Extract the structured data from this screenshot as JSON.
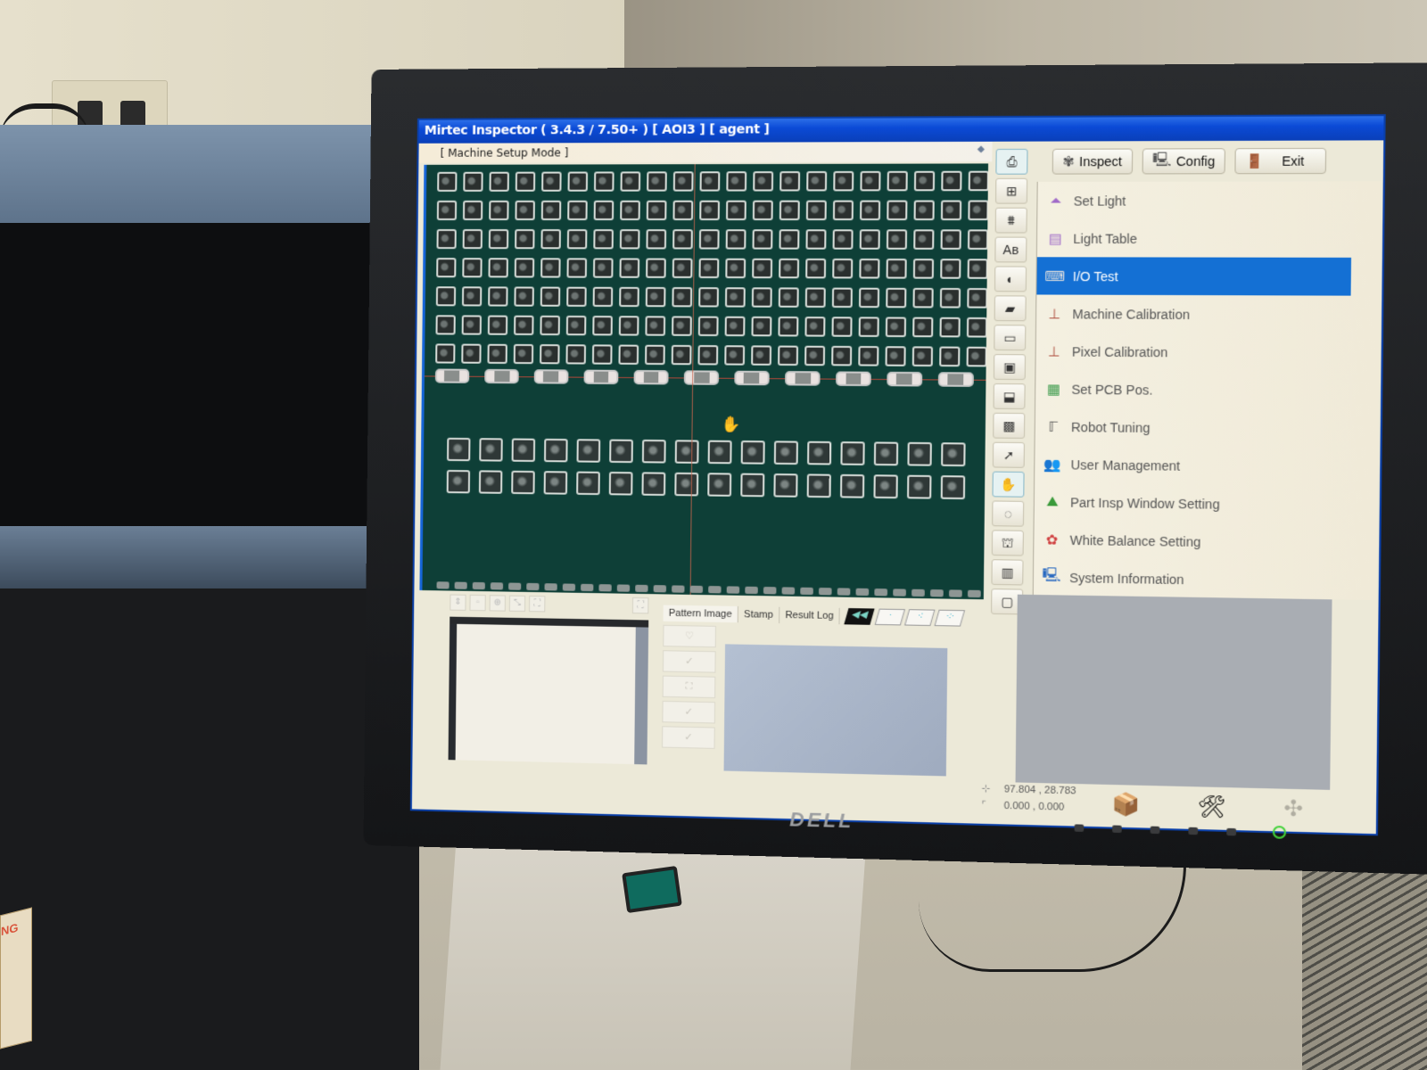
{
  "window": {
    "title": "Mirtec Inspector ( 3.4.3 / 7.50+ ) [ AOI3 ] [ agent ]",
    "mode_label": "[ Machine Setup Mode ]"
  },
  "toolbar": {
    "inspect_label": "Inspect",
    "config_label": "Config",
    "exit_label": "Exit",
    "inspect_icon": "gear-flower-icon",
    "config_icon": "config-computer-icon",
    "exit_icon": "exit-door-icon"
  },
  "menu": {
    "items": [
      {
        "label": "Set Light",
        "icon": "lamp-icon",
        "glyph": "⏶",
        "color": "#a06bc8"
      },
      {
        "label": "Light Table",
        "icon": "light-table-icon",
        "glyph": "▤",
        "color": "#a06bc8"
      },
      {
        "label": "I/O Test",
        "icon": "io-test-icon",
        "glyph": "⌨",
        "color": "#dddddd"
      },
      {
        "label": "Machine Calibration",
        "icon": "machine-calibration-icon",
        "glyph": "⊥",
        "color": "#b05040"
      },
      {
        "label": "Pixel Calibration",
        "icon": "pixel-calibration-icon",
        "glyph": "⊥",
        "color": "#b05040"
      },
      {
        "label": "Set PCB Pos.",
        "icon": "pcb-position-icon",
        "glyph": "▦",
        "color": "#3a9a4a"
      },
      {
        "label": "Robot Tuning",
        "icon": "robot-tuning-icon",
        "glyph": "ℾ",
        "color": "#555555"
      },
      {
        "label": "User Management",
        "icon": "users-icon",
        "glyph": "👥",
        "color": "#2a9ac0"
      },
      {
        "label": "Part Insp Window Setting",
        "icon": "part-window-icon",
        "glyph": "⛰",
        "color": "#3a9a3a"
      },
      {
        "label": "White Balance Setting",
        "icon": "rgb-balance-icon",
        "glyph": "✿",
        "color": "#d04040"
      },
      {
        "label": "System Information",
        "icon": "system-info-icon",
        "glyph": "🖳",
        "color": "#2a6ac0"
      }
    ],
    "selected_index": 2
  },
  "side_icons": [
    {
      "name": "teach-icon",
      "glyph": "⎙"
    },
    {
      "name": "grid-icon",
      "glyph": "⊞"
    },
    {
      "name": "profile-icon",
      "glyph": "⩩"
    },
    {
      "name": "text-ab-icon",
      "glyph": "Aʙ"
    },
    {
      "name": "contrast-icon",
      "glyph": "◐"
    },
    {
      "name": "chip-icon",
      "glyph": "▰"
    },
    {
      "name": "component-icon",
      "glyph": "▭"
    },
    {
      "name": "ic-package-icon",
      "glyph": "▣"
    },
    {
      "name": "connector-icon",
      "glyph": "⬓"
    },
    {
      "name": "sop-chip-icon",
      "glyph": "▩"
    },
    {
      "name": "pointer-icon",
      "glyph": "➚"
    },
    {
      "name": "hand-pan-icon",
      "glyph": "✋"
    },
    {
      "name": "rotate-icon",
      "glyph": "◌"
    },
    {
      "name": "conveyor-icon",
      "glyph": "⛫"
    },
    {
      "name": "save-icon",
      "glyph": "▥"
    },
    {
      "name": "document-icon",
      "glyph": "▢"
    }
  ],
  "bottom_tabs": {
    "pattern_image": "Pattern Image",
    "stamp": "Stamp",
    "result_log": "Result Log"
  },
  "coordinates": {
    "position": "97.804 , 28.783",
    "offset": "0.000 , 0.000"
  },
  "bottom_tools": [
    {
      "name": "package-box-icon",
      "glyph": "📦"
    },
    {
      "name": "tools-wrench-icon",
      "glyph": "🛠"
    },
    {
      "name": "disabled-tool-icon",
      "glyph": "✣"
    }
  ],
  "monitor": {
    "brand": "DELL"
  },
  "environment": {
    "warning_label_text": "NG"
  }
}
